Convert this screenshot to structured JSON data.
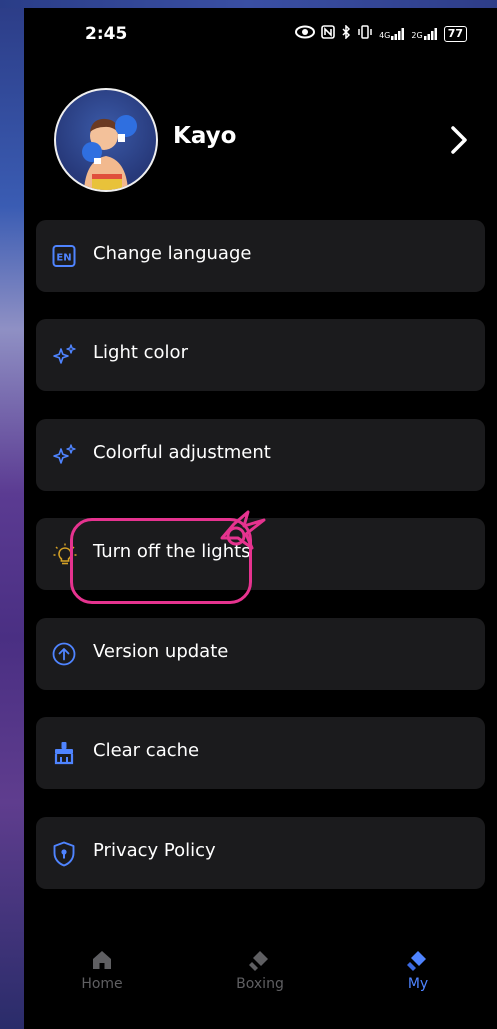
{
  "status_bar": {
    "time": "2:45",
    "network_4g": "4G",
    "network_2g": "2G",
    "battery": "77"
  },
  "profile": {
    "name": "Kayo",
    "avatar_icon": "boxer-avatar"
  },
  "menu": [
    {
      "label": "Change language",
      "icon": "language-en-icon"
    },
    {
      "label": "Light color",
      "icon": "sparkle-icon"
    },
    {
      "label": "Colorful adjustment",
      "icon": "sparkle-icon"
    },
    {
      "label": "Turn off the lights",
      "icon": "lightbulb-icon"
    },
    {
      "label": "Version update",
      "icon": "arrow-up-circle-icon"
    },
    {
      "label": "Clear cache",
      "icon": "broom-icon"
    },
    {
      "label": "Privacy Policy",
      "icon": "shield-icon"
    }
  ],
  "en_badge": "EN",
  "tabs": [
    {
      "label": "Home",
      "active": false
    },
    {
      "label": "Boxing",
      "active": false
    },
    {
      "label": "My",
      "active": true
    }
  ],
  "colors": {
    "accent": "#4f84ff",
    "card": "#1b1b1d",
    "annotation": "#e6338f"
  }
}
